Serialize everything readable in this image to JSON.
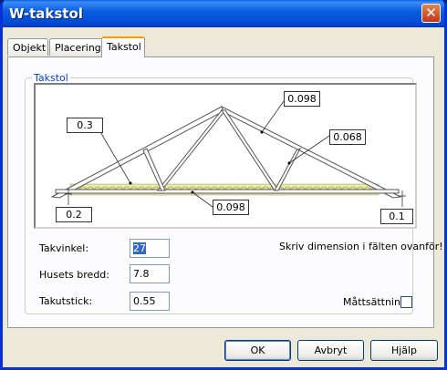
{
  "window": {
    "title": "W-takstol",
    "close_glyph": "✕"
  },
  "tabs": [
    {
      "label": "Objekt"
    },
    {
      "label": "Placering"
    },
    {
      "label": "Takstol"
    }
  ],
  "group": {
    "label": "Takstol"
  },
  "drawing": {
    "callouts": {
      "top_left": "0.3",
      "top_right": "0.098",
      "right": "0.068",
      "bottom_center": "0.098",
      "bottom_left": "0.2",
      "bottom_right": "0.1"
    }
  },
  "form": {
    "takvinkel": {
      "label": "Takvinkel:",
      "value": "27"
    },
    "husets_bredd": {
      "label": "Husets bredd:",
      "value": "7.8"
    },
    "takutstick": {
      "label": "Takutstick:",
      "value": "0.55"
    },
    "hint": "Skriv dimension i fälten ovanför!",
    "mattsattning": {
      "label": "Måttsättning",
      "checked": false
    }
  },
  "buttons": {
    "ok": "OK",
    "cancel": "Avbryt",
    "help": "Hjälp"
  }
}
